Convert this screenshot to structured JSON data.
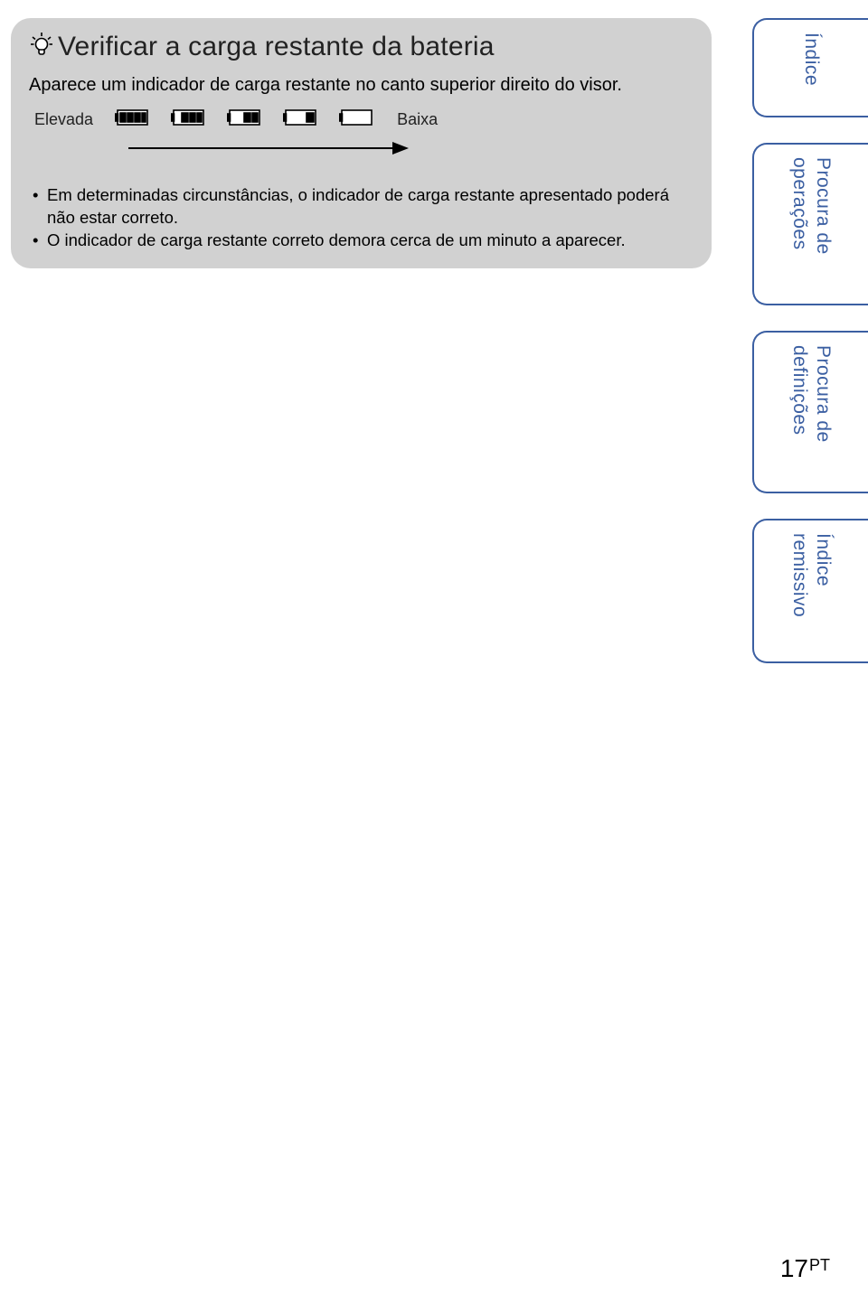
{
  "callout": {
    "title": "Verificar a carga restante da bateria",
    "body": "Aparece um indicador de carga restante no canto superior direito do visor.",
    "level_high": "Elevada",
    "level_low": "Baixa",
    "bullets": [
      "Em determinadas circunstâncias, o indicador de carga restante apresentado poderá não estar correto.",
      "O indicador de carga restante correto demora cerca de um minuto a aparecer."
    ]
  },
  "tabs": {
    "t1": "Índice",
    "t2a": "Procura de",
    "t2b": "operações",
    "t3a": "Procura de",
    "t3b": "definições",
    "t4a": "Índice",
    "t4b": "remissivo"
  },
  "page_number": "17",
  "page_lang": "PT",
  "battery_levels": [
    4,
    3,
    2,
    1,
    0
  ]
}
